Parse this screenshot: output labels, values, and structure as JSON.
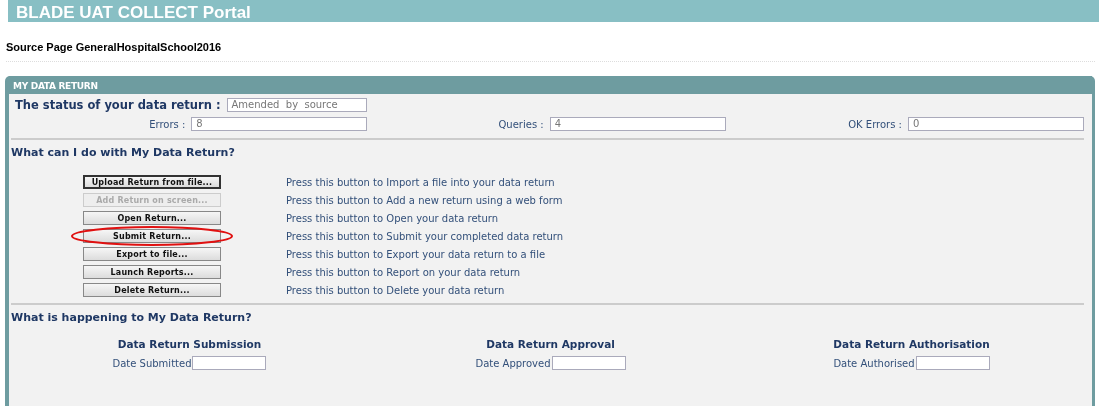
{
  "header": {
    "title": "BLADE UAT COLLECT Portal"
  },
  "source_page": "Source Page GeneralHospitalSchool2016",
  "panel": {
    "title": "MY DATA RETURN",
    "status": {
      "label": "The status of your data return :",
      "value": "Amended  by  source"
    },
    "counts": [
      {
        "label": "Errors :",
        "value": "8"
      },
      {
        "label": "Queries :",
        "value": "4"
      },
      {
        "label": "OK Errors :",
        "value": "0"
      }
    ],
    "actions_heading": "What can I do with My Data Return?",
    "actions": [
      {
        "button": "Upload Return from file...",
        "description": "Press this button to Import a file into your data return",
        "disabled": false,
        "focused": true,
        "circled": false
      },
      {
        "button": "Add Return on screen...",
        "description": "Press this button to Add a new return using a web form",
        "disabled": true,
        "focused": false,
        "circled": false
      },
      {
        "button": "Open Return...",
        "description": "Press this button to Open your data return",
        "disabled": false,
        "focused": false,
        "circled": false
      },
      {
        "button": "Submit Return...",
        "description": "Press this button to Submit your completed data return",
        "disabled": false,
        "focused": false,
        "circled": true
      },
      {
        "button": "Export to file...",
        "description": "Press this button to Export your data return to a file",
        "disabled": false,
        "focused": false,
        "circled": false
      },
      {
        "button": "Launch Reports...",
        "description": "Press this button to Report on your data return",
        "disabled": false,
        "focused": false,
        "circled": false
      },
      {
        "button": "Delete Return...",
        "description": "Press this button to Delete your data return",
        "disabled": false,
        "focused": false,
        "circled": false
      }
    ],
    "progress_heading": "What is happening to My Data Return?",
    "stages": [
      {
        "title": "Data Return Submission",
        "label": "Date Submitted"
      },
      {
        "title": "Data Return Approval",
        "label": "Date Approved"
      },
      {
        "title": "Data Return Authorisation",
        "label": "Date Authorised"
      }
    ]
  }
}
